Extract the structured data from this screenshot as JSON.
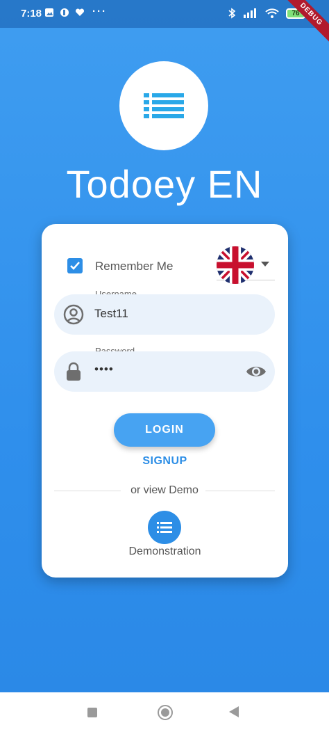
{
  "status_bar": {
    "time": "7:18",
    "battery": "76",
    "debug_banner": "DEBUG",
    "more": "···"
  },
  "app": {
    "title": "Todoey EN"
  },
  "login_card": {
    "remember_me": {
      "label": "Remember Me",
      "checked": true
    },
    "language": {
      "selected": "English (UK)",
      "flag": "uk-flag-icon"
    },
    "username": {
      "label": "Username",
      "value": "Test11"
    },
    "password": {
      "label": "Password",
      "value": "••••"
    },
    "login_button": "LOGIN",
    "signup_link": "SIGNUP",
    "divider_text": "or view Demo",
    "demo_label": "Demonstration"
  },
  "colors": {
    "primary": "#2d8ee6",
    "background": "#3f9df0",
    "field_bg": "#eaf2fb"
  }
}
